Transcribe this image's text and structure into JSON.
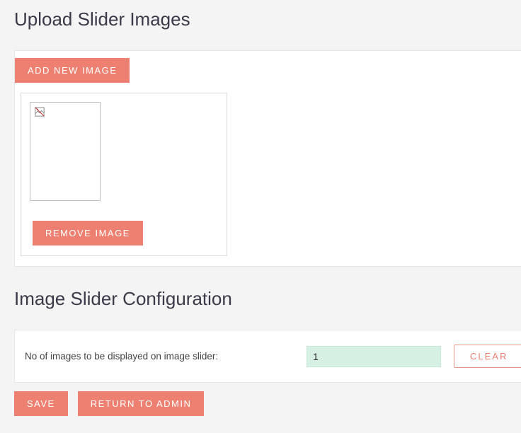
{
  "upload": {
    "heading": "Upload Slider Images",
    "add_button": "ADD NEW IMAGE",
    "remove_button": "REMOVE IMAGE"
  },
  "config": {
    "heading": "Image Slider Configuration",
    "count_label": "No of images to be displayed on image slider:",
    "count_value": "1",
    "clear_button": "CLEAR"
  },
  "actions": {
    "save": "SAVE",
    "return": "RETURN TO ADMIN"
  }
}
